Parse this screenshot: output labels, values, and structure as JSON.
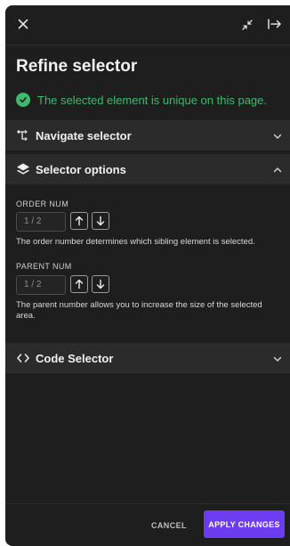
{
  "header": {
    "close_icon": "close-icon",
    "collapse_icon": "collapse-arrows-icon",
    "dock_icon": "dock-right-icon"
  },
  "title": "Refine selector",
  "status": {
    "message": "The selected element is unique on this page.",
    "color": "#3fb96c"
  },
  "sections": {
    "navigate": {
      "label": "Navigate selector",
      "expanded": false
    },
    "options": {
      "label": "Selector options",
      "expanded": true
    },
    "code": {
      "label": "Code Selector",
      "expanded": false
    }
  },
  "options": {
    "order": {
      "label": "ORDER NUM",
      "value": "1 / 2",
      "description": "The order number determines which sibling element is selected."
    },
    "parent": {
      "label": "PARENT NUM",
      "value": "1 / 2",
      "description": "The parent number allows you to increase the size of the selected area."
    }
  },
  "footer": {
    "cancel_label": "CANCEL",
    "apply_label": "APPLY CHANGES",
    "accent": "#6c3df0"
  }
}
